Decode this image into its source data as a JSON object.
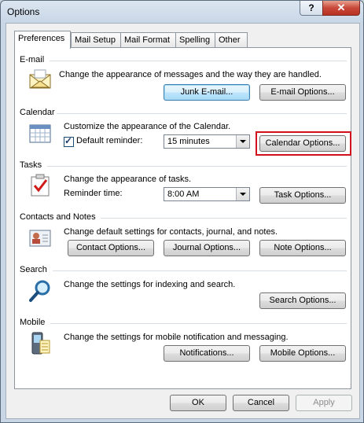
{
  "window": {
    "title": "Options",
    "help_glyph": "?",
    "close_glyph": "✕"
  },
  "tabs": [
    {
      "label": "Preferences"
    },
    {
      "label": "Mail Setup"
    },
    {
      "label": "Mail Format"
    },
    {
      "label": "Spelling"
    },
    {
      "label": "Other"
    }
  ],
  "email": {
    "heading": "E-mail",
    "description": "Change the appearance of messages and the way they are handled.",
    "junk_button": "Junk E-mail...",
    "options_button": "E-mail Options..."
  },
  "calendar": {
    "heading": "Calendar",
    "description": "Customize the appearance of the Calendar.",
    "reminder_label": "Default reminder:",
    "reminder_checked": true,
    "reminder_value": "15 minutes",
    "options_button": "Calendar Options..."
  },
  "tasks": {
    "heading": "Tasks",
    "description": "Change the appearance of tasks.",
    "reminder_label": "Reminder time:",
    "reminder_value": "8:00 AM",
    "options_button": "Task Options..."
  },
  "contacts": {
    "heading": "Contacts and Notes",
    "description": "Change default settings for contacts, journal, and notes.",
    "contact_button": "Contact Options...",
    "journal_button": "Journal Options...",
    "note_button": "Note Options..."
  },
  "search": {
    "heading": "Search",
    "description": "Change the settings for indexing and search.",
    "options_button": "Search Options..."
  },
  "mobile": {
    "heading": "Mobile",
    "description": "Change the settings for mobile notification and messaging.",
    "notifications_button": "Notifications...",
    "options_button": "Mobile Options..."
  },
  "footer": {
    "ok": "OK",
    "cancel": "Cancel",
    "apply": "Apply"
  },
  "colors": {
    "highlight_box": "#d1101d",
    "titlebar": "#dce6f1",
    "close_button": "#c8493a"
  }
}
